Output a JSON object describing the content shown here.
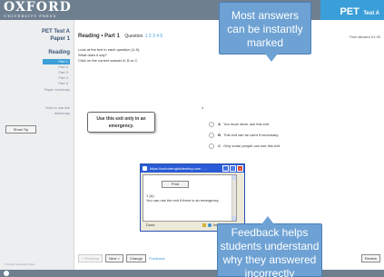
{
  "header": {
    "logo_main": "OXFORD",
    "logo_sub": "UNIVERSITY PRESS",
    "test_title_main": "PET",
    "test_title_sub": "Test A"
  },
  "sidebar": {
    "test_label": "PET Test A",
    "paper_label_1": "Paper 1",
    "paper_label_2": "Reading",
    "parts": [
      "Part 1",
      "Part 2",
      "Part 3",
      "Part 4",
      "Part 5"
    ],
    "paper_summary": "Paper summary",
    "how_to_line1": "How to use the",
    "how_to_line2": "dictionary",
    "show_tip": "Show Tip",
    "copyright": "© Oxford University Press"
  },
  "main": {
    "reading_part": "Reading • Part 1",
    "question_label": "Question",
    "question_numbers": "1 2 3 4 5",
    "time_allowed": "Time allowed 01:30",
    "instructions": [
      "Look at the text in each question (1-5).",
      "What does it say?",
      "Click on the correct answer A, B or C."
    ],
    "notice_line1": "Use this exit only in an",
    "notice_line2": "emergency.",
    "question_number": "1",
    "options": [
      {
        "letter": "A",
        "text": "You must never use this exit."
      },
      {
        "letter": "B",
        "text": "This exit can be used if necessary."
      },
      {
        "letter": "C",
        "text": "Only some people can use this exit."
      }
    ]
  },
  "popup": {
    "title": "https://oxfordenglishtesting.com - ...",
    "print_label": "Print",
    "answer_line1": "1 (A)",
    "answer_line2": "You can use the exit if there is an emergency.",
    "status_done": "Done",
    "status_zone": "Internet"
  },
  "bottom_nav": {
    "previous": "< Previous",
    "next": "Next >",
    "change": "Change",
    "feedback": "Feedback",
    "review": "Review"
  },
  "callouts": {
    "top_lines": [
      "Most answers",
      "can be instantly",
      "marked"
    ],
    "bottom_lines": [
      "Feedback helps",
      "students understand",
      "why they answered",
      "incorrectly"
    ]
  },
  "colors": {
    "header_bg": "#6e7f90",
    "accent": "#3a9ed8",
    "callout_bg": "#6ea2d4"
  }
}
